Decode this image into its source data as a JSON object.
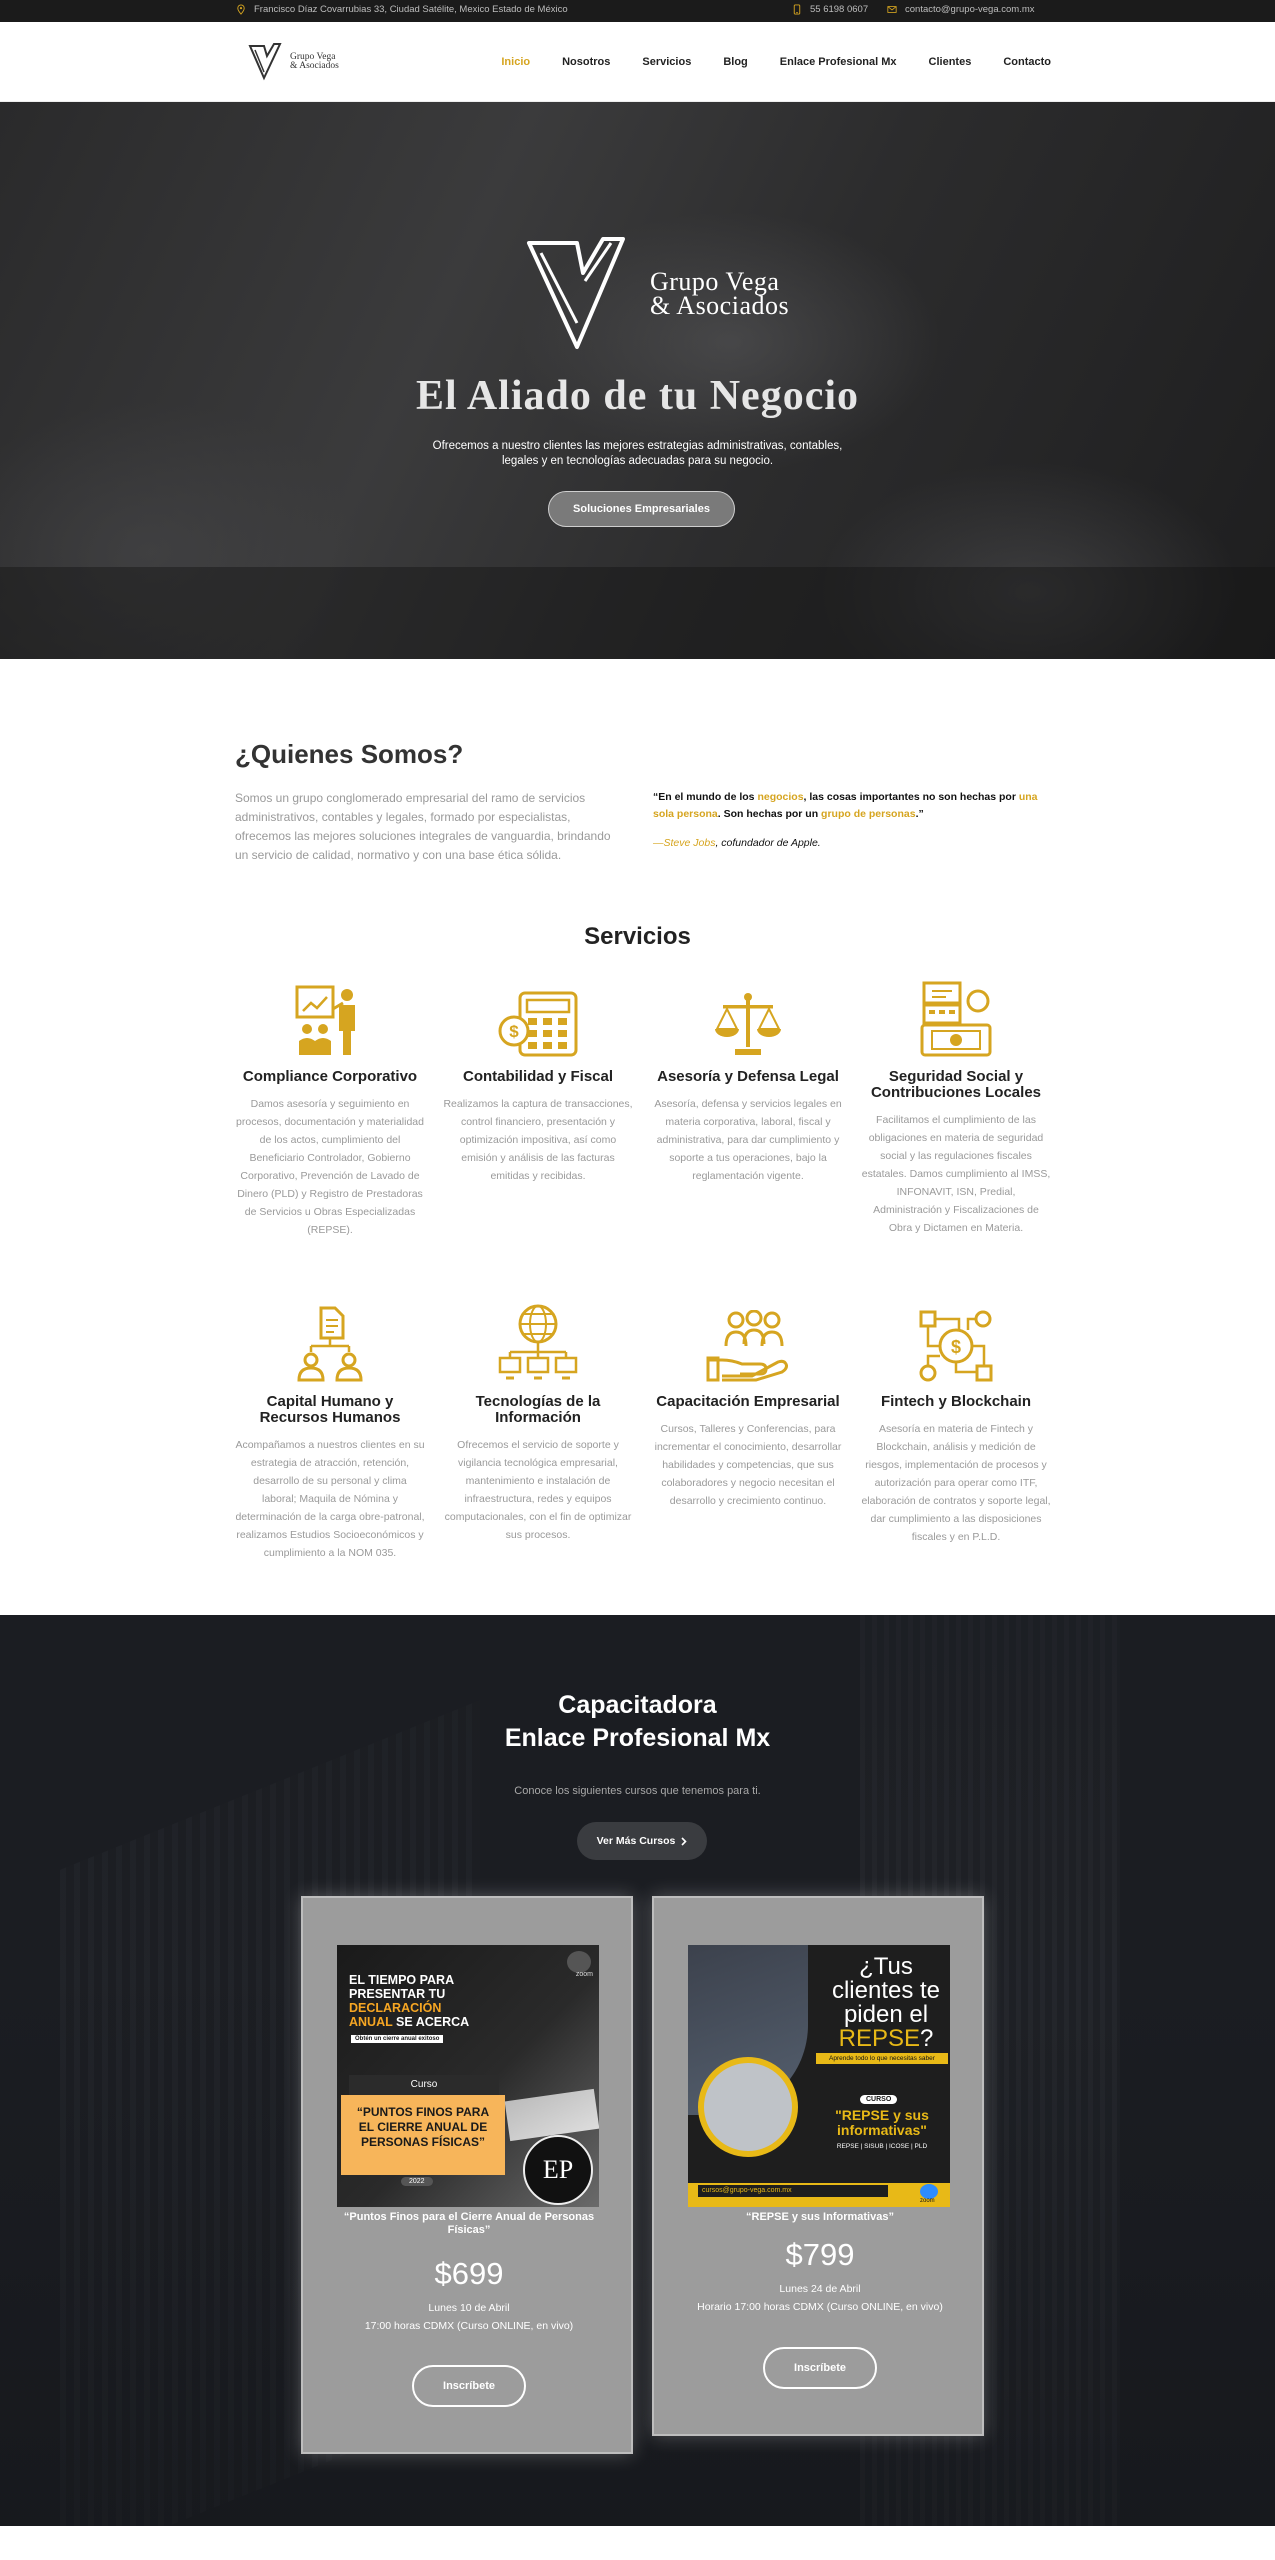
{
  "topbar": {
    "address": "Francisco Díaz Covarrubias 33, Ciudad Satélite, Mexico Estado de México",
    "phone": "55 6198 0607",
    "email": "contacto@grupo-vega.com.mx"
  },
  "logo": {
    "line1": "Grupo Vega",
    "line2": "& Asociados"
  },
  "nav": {
    "items": [
      "Inicio",
      "Nosotros",
      "Servicios",
      "Blog",
      "Enlace Profesional Mx",
      "Clientes",
      "Contacto"
    ],
    "active": "Inicio"
  },
  "hero": {
    "logo_line1": "Grupo Vega",
    "logo_line2": "& Asociados",
    "title": "El Aliado de tu Negocio",
    "subtitle": "Ofrecemos a nuestro clientes las mejores estrategias administrativas, contables, legales y en tecnologías adecuadas para su negocio.",
    "button": "Soluciones Empresariales"
  },
  "about": {
    "title": "¿Quienes Somos?",
    "description": "Somos un grupo conglomerado empresarial del ramo de servicios administrativos, contables y legales, formado por especialistas, ofrecemos las mejores soluciones integrales de vanguardia, brindando un servicio de calidad, normativo y con una base ética sólida.",
    "quote_parts": [
      "“En el mundo de los ",
      "negocios",
      ", las cosas importantes no son hechas por ",
      "una sola persona",
      ". Son hechas por un ",
      "grupo de personas",
      ".”"
    ],
    "author_name": "—Steve Jobs",
    "author_role": ", cofundador de Apple."
  },
  "services": {
    "title": "Servicios",
    "items": [
      {
        "title": "Compliance Corporativo",
        "text": "Damos asesoría y seguimiento en procesos, documentación y materialidad de los actos, cumplimiento del Beneficiario Controlador, Gobierno Corporativo, Prevención de Lavado de Dinero (PLD) y Registro de Prestadoras de Servicios u Obras Especializadas (REPSE).",
        "icon": "presentation-icon"
      },
      {
        "title": "Contabilidad y Fiscal",
        "text": "Realizamos la captura de transacciones, control financiero, presentación y optimización impositiva, así como emisión y análisis de las facturas emitidas y recibidas.",
        "icon": "calculator-icon"
      },
      {
        "title": "Asesoría y Defensa Legal",
        "text": "Asesoría, defensa y servicios legales en materia corporativa, laboral, fiscal y administrativa, para dar cumplimiento y soporte a tus operaciones, bajo la reglamentación vigente.",
        "icon": "scales-icon"
      },
      {
        "title": "Seguridad Social y Contribuciones Locales",
        "text": "Facilitamos el cumplimiento de las obligaciones en materia de seguridad social y las regulaciones fiscales estatales. Damos cumplimiento al IMSS, INFONAVIT, ISN, Predial, Administración y Fiscalizaciones de Obra y Dictamen en Materia.",
        "icon": "cash-register-icon"
      },
      {
        "title": "Capital Humano y Recursos Humanos",
        "text": "Acompañamos a nuestros clientes en su estrategia de atracción, retención, desarrollo de su personal y clima laboral; Maquila de Nómina y determinación de la carga obre-patronal, realizamos Estudios Socioeconómicos y cumplimiento a la NOM 035.",
        "icon": "org-chart-icon"
      },
      {
        "title": "Tecnologías de la Información",
        "text": "Ofrecemos el servicio de soporte y vigilancia tecnológica empresarial, mantenimiento e instalación de infraestructura, redes y equipos computacionales, con el fin de optimizar sus procesos.",
        "icon": "network-icon"
      },
      {
        "title": "Capacitación Empresarial",
        "text": "Cursos, Talleres y Conferencias, para incrementar el conocimiento, desarrollar habilidades y competencias, que sus colaboradores y negocio necesitan el desarrollo y crecimiento continuo.",
        "icon": "team-hand-icon"
      },
      {
        "title": "Fintech y Blockchain",
        "text": "Asesoría en materia de Fintech y Blockchain, análisis y medición de riesgos, implementación de procesos y autorización para operar como ITF, elaboración de contratos y soporte legal, dar cumplimiento a las disposiciones fiscales y en P.L.D.",
        "icon": "blockchain-icon"
      }
    ]
  },
  "training": {
    "title_line1": "Capacitadora",
    "title_line2": "Enlace Profesional Mx",
    "subtitle": "Conoce los siguientes cursos que tenemos para ti.",
    "button": "Ver Más Cursos",
    "courses": [
      {
        "poster": {
          "l1": "EL TIEMPO PARA",
          "l2": "PRESENTAR TU",
          "l3": "DECLARACIÓN",
          "l4a": "ANUAL",
          "l4b": " SE ACERCA",
          "tag": "Obtén un cierre anual exitoso",
          "badge": "Curso",
          "box": "“PUNTOS FINOS PARA EL CIERRE ANUAL DE PERSONAS FÍSICAS”",
          "year": "2022",
          "monogram": "EP",
          "zoom": "zoom"
        },
        "title": "“Puntos Finos para el Cierre Anual de Personas Físicas”",
        "price": "$699",
        "date": "Lunes 10 de Abril",
        "time": "17:00 horas CDMX (Curso ONLINE, en vivo)",
        "button": "Inscríbete"
      },
      {
        "poster": {
          "q1": "¿Tus",
          "q2": "clientes te",
          "q3": "piden el",
          "q4": "REPSE",
          "q5": "?",
          "strip": "Aprende todo lo que necesitas saber",
          "badge": "CURSO",
          "box1": "\"REPSE y sus",
          "box2": "informativas\"",
          "tags": "REPSE | SISUB | ICOSE | PLD",
          "email": "cursos@grupo-vega.com.mx",
          "zoom": "zoom"
        },
        "title": "“REPSE y sus Informativas”",
        "price": "$799",
        "date": "Lunes 24 de Abril",
        "time": "Horario 17:00 horas CDMX (Curso ONLINE, en vivo)",
        "button": "Inscríbete"
      }
    ]
  },
  "colors": {
    "accent": "#d6a520",
    "dark": "#1b1b1b",
    "card": "#9c9c9c"
  }
}
